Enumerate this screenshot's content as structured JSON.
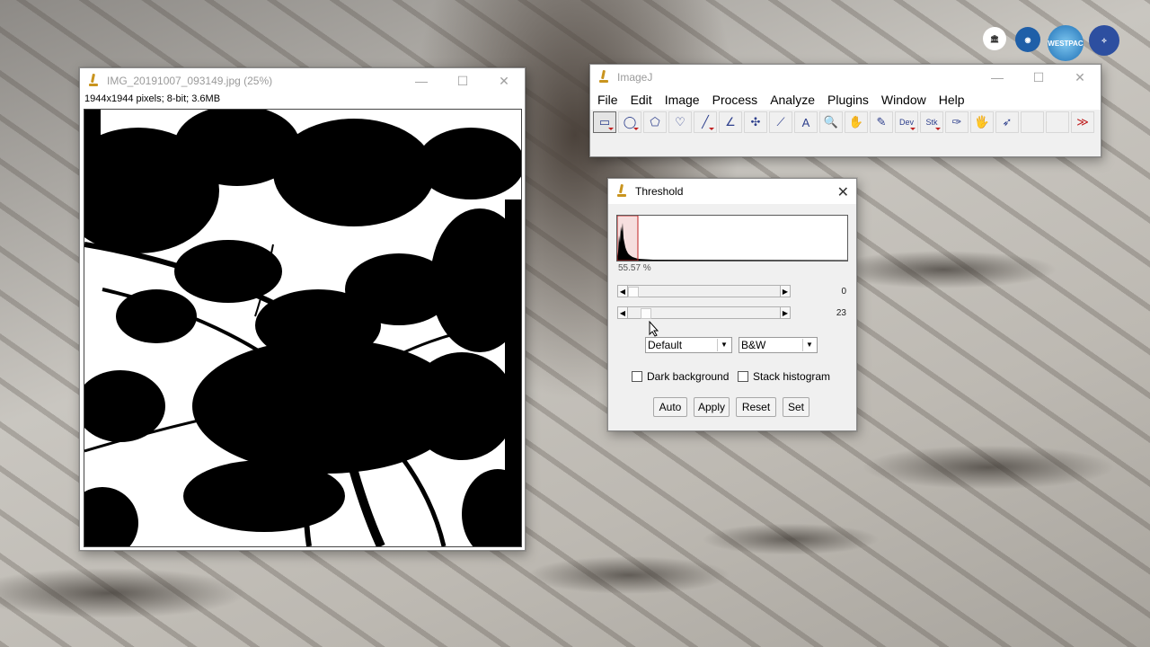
{
  "image_window": {
    "title": "IMG_20191007_093149.jpg (25%)",
    "info": "1944x1944 pixels; 8-bit; 3.6MB"
  },
  "imagej": {
    "title": "ImageJ",
    "menu": [
      "File",
      "Edit",
      "Image",
      "Process",
      "Analyze",
      "Plugins",
      "Window",
      "Help"
    ],
    "tools": [
      {
        "name": "rectangle-tool-icon",
        "glyph": "▭"
      },
      {
        "name": "oval-tool-icon",
        "glyph": "◯"
      },
      {
        "name": "polygon-tool-icon",
        "glyph": "⬠"
      },
      {
        "name": "freehand-tool-icon",
        "glyph": "♡"
      },
      {
        "name": "line-tool-icon",
        "glyph": "╱"
      },
      {
        "name": "angle-tool-icon",
        "glyph": "∠"
      },
      {
        "name": "point-tool-icon",
        "glyph": "✣"
      },
      {
        "name": "wand-tool-icon",
        "glyph": "⟋"
      },
      {
        "name": "text-tool-icon",
        "glyph": "A"
      },
      {
        "name": "magnifier-tool-icon",
        "glyph": "🔍"
      },
      {
        "name": "hand-tool-icon",
        "glyph": "✋"
      },
      {
        "name": "color-picker-tool-icon",
        "glyph": "✎"
      },
      {
        "name": "dev-tool-icon",
        "glyph": "Dev"
      },
      {
        "name": "stk-tool-icon",
        "glyph": "Stk"
      },
      {
        "name": "brush-tool-icon",
        "glyph": "✑"
      },
      {
        "name": "flood-fill-tool-icon",
        "glyph": "🖐"
      },
      {
        "name": "arrow-tool-icon",
        "glyph": "➶"
      },
      {
        "name": "empty-tool-1",
        "glyph": ""
      },
      {
        "name": "empty-tool-2",
        "glyph": ""
      },
      {
        "name": "more-tools-icon",
        "glyph": "≫"
      }
    ]
  },
  "threshold": {
    "title": "Threshold",
    "percent": "55.57 %",
    "min_value": "0",
    "max_value": "23",
    "min_fraction": 0.0,
    "max_fraction": 0.09,
    "method": "Default",
    "mode": "B&W",
    "dark_background_label": "Dark background",
    "dark_background_checked": false,
    "stack_histogram_label": "Stack histogram",
    "stack_histogram_checked": false,
    "buttons": [
      "Auto",
      "Apply",
      "Reset",
      "Set"
    ]
  },
  "logos": [
    "WESTPAC"
  ],
  "colors": {
    "threshold_red": "#c02020",
    "tool_blue": "#2c3e8c"
  }
}
